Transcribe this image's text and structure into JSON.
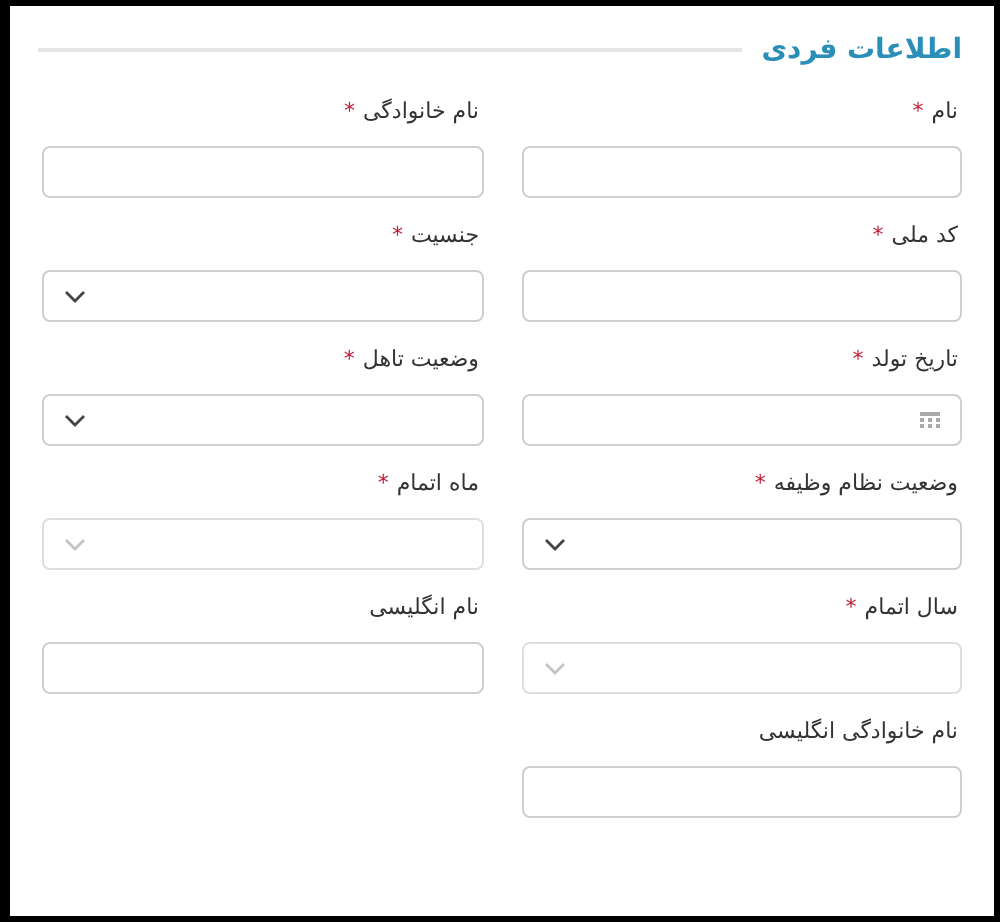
{
  "section": {
    "title": "اطلاعات فردی"
  },
  "fields": [
    {
      "label": "نام",
      "mark": "*",
      "kind": "text",
      "disabled": false
    },
    {
      "label": "نام خانوادگی",
      "mark": "*",
      "kind": "text",
      "disabled": false
    },
    {
      "label": "کد ملی",
      "mark": "*",
      "kind": "text",
      "disabled": false
    },
    {
      "label": "جنسیت",
      "mark": "*",
      "kind": "select",
      "disabled": false
    },
    {
      "label": "تاریخ تولد",
      "mark": "*",
      "kind": "date",
      "disabled": false
    },
    {
      "label": "وضعیت تاهل",
      "mark": "*",
      "kind": "select",
      "disabled": false
    },
    {
      "label": "وضعیت نظام وظیفه",
      "mark": "*",
      "kind": "select",
      "disabled": false
    },
    {
      "label": "ماه اتمام",
      "mark": "*",
      "kind": "select",
      "disabled": true
    },
    {
      "label": "سال اتمام",
      "mark": "*",
      "kind": "select",
      "disabled": true
    },
    {
      "label": "نام انگلیسی",
      "kind": "text",
      "disabled": false
    },
    {
      "label": "نام خانوادگی انگلیسی",
      "kind": "text",
      "disabled": false
    }
  ]
}
